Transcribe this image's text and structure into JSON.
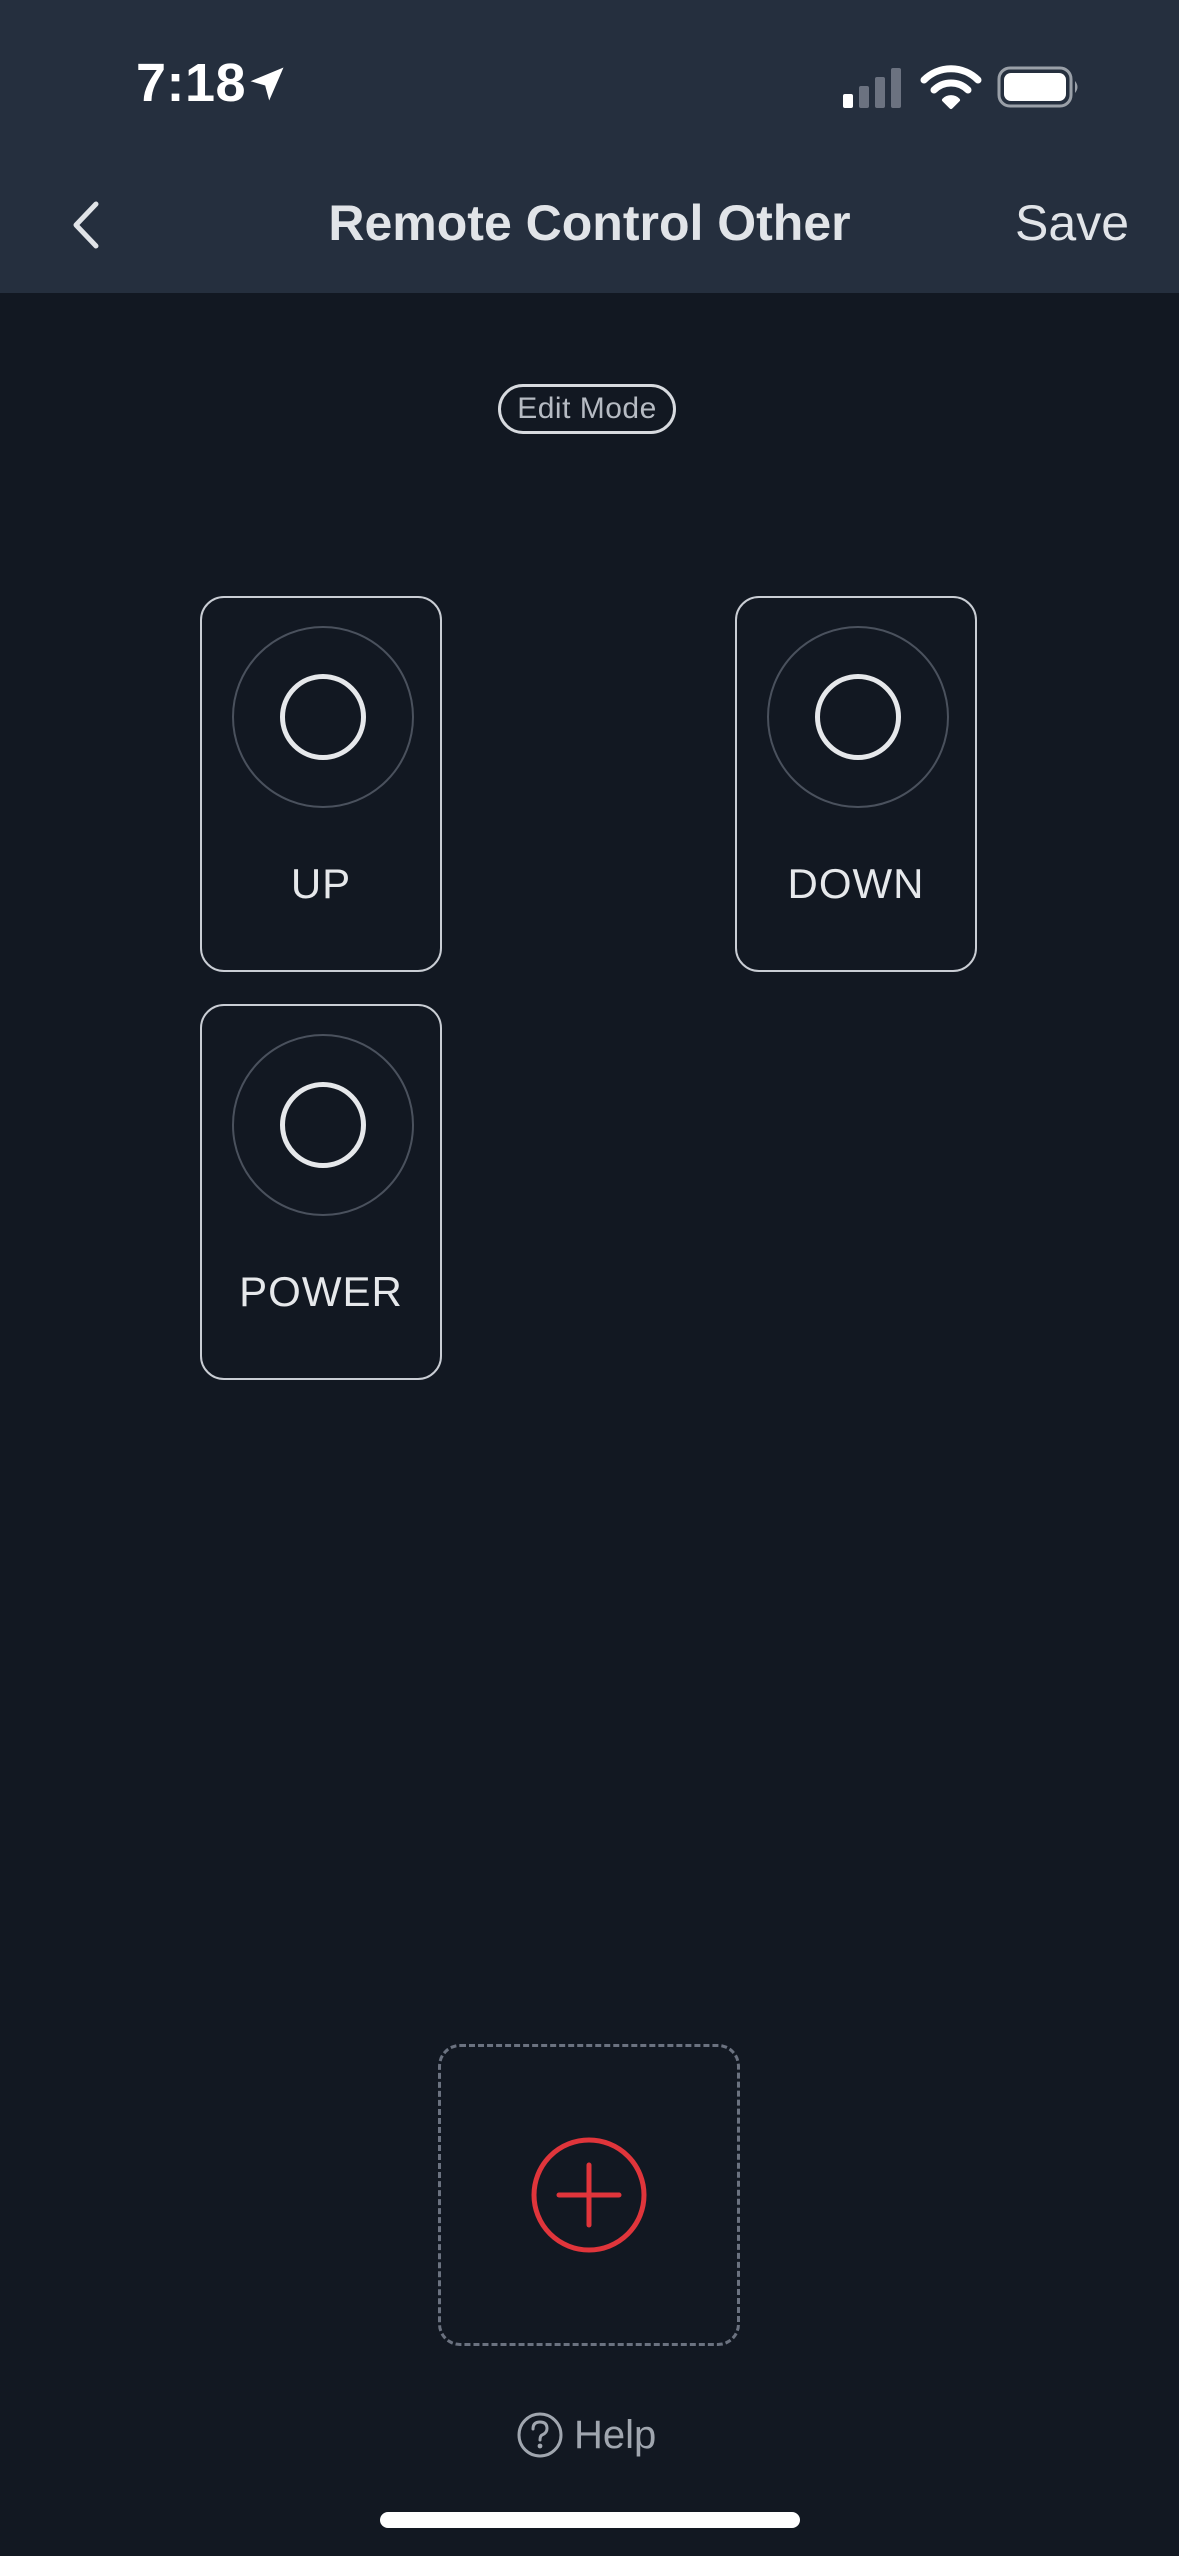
{
  "status_bar": {
    "time": "7:18",
    "icons": [
      "location-arrow-icon",
      "cellular-signal-icon",
      "wifi-icon",
      "battery-icon"
    ]
  },
  "header": {
    "back_icon": "chevron-left-icon",
    "title": "Remote Control Other",
    "save_label": "Save"
  },
  "edit_mode": {
    "label": "Edit Mode"
  },
  "remote_keys": [
    {
      "label": "UP",
      "icon": "circle-icon"
    },
    {
      "label": "DOWN",
      "icon": "circle-icon"
    },
    {
      "label": "POWER",
      "icon": "circle-icon"
    }
  ],
  "add_button": {
    "icon": "plus-circle-icon"
  },
  "help": {
    "icon": "question-circle-icon",
    "label": "Help"
  },
  "colors": {
    "header_bg": "#252f3e",
    "page_bg": "#121822",
    "accent_red": "#e0353b",
    "text": "#e6e8eb"
  }
}
